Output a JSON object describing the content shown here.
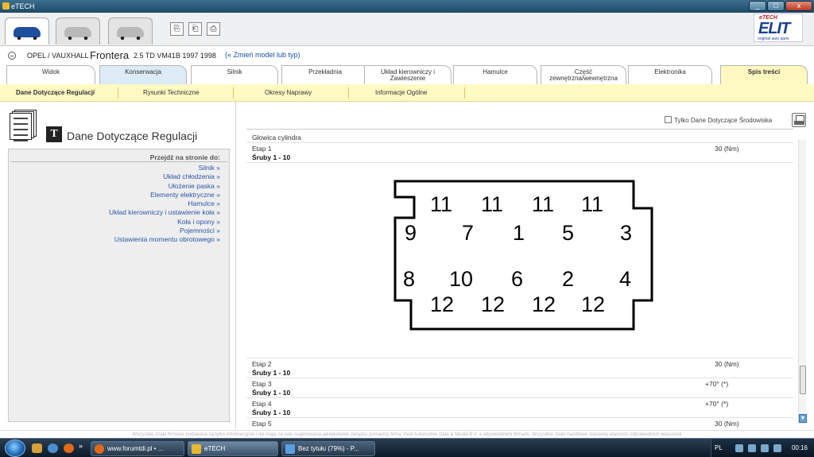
{
  "window": {
    "title": "eTECH",
    "buttons": [
      "_",
      "□",
      "x"
    ]
  },
  "toolbar": {
    "tools": [
      "⎘",
      "⎗",
      "⎙"
    ],
    "logo": {
      "brand_top": "eTECH",
      "brand": "ELIT",
      "tagline": "original auto parts"
    }
  },
  "vehicle": {
    "make": "OPEL / VAUXHALL",
    "model": "Frontera",
    "spec": "2.5 TD VM41B 1997 1998",
    "change_link": "(« Zmień model lub typ)"
  },
  "main_tabs": [
    "Widok",
    "Konserwacja",
    "Silnik",
    "Przekładnia",
    "Układ kierowniczy i Zawieszenie",
    "Hamulce",
    "Część zewnętrzna/wewnętrzna",
    "Elektronika",
    "Spis treści"
  ],
  "sub_tabs": [
    "Dane Dotyczące Regulacji",
    "Rysunki Techniczne",
    "Okresy Naprawy",
    "Informacje Ogólne"
  ],
  "left_panel": {
    "title": "Dane Dotyczące Regulacji",
    "jump_title": "Przejdź na stronie do:",
    "links": [
      "Silnik »",
      "Układ chłodzenia »",
      "Ułożenie paska »",
      "Elementy elektryczne »",
      "Hamulce »",
      "Układ kierowniczy i ustawienie koła »",
      "Koła i opony »",
      "Pojemności »",
      "Ustawienia momentu obrotowego »"
    ]
  },
  "content": {
    "env_filter_label": "Tylko Dane Dotyczące Środowiska",
    "section": "Głowica cylindra",
    "steps": [
      {
        "etap": "Etap 1",
        "bolts": "Śruby 1 - 10",
        "value": "30 (Nm)"
      },
      {
        "etap": "Etap 2",
        "bolts": "Śruby 1 - 10",
        "value": "30 (Nm)"
      },
      {
        "etap": "Etap 3",
        "bolts": "Śruby 1 - 10",
        "value": "+70° (*)"
      },
      {
        "etap": "Etap 4",
        "bolts": "Śruby 1 - 10",
        "value": "+70° (*)"
      },
      {
        "etap": "Etap 5",
        "bolts": "",
        "value": "30 (Nm)"
      }
    ],
    "diagram": {
      "row_top": [
        "11",
        "11",
        "11",
        "11"
      ],
      "row_upper": [
        "9",
        "7",
        "1",
        "5",
        "3"
      ],
      "row_lower": [
        "8",
        "10",
        "6",
        "2",
        "4"
      ],
      "row_bottom": [
        "12",
        "12",
        "12",
        "12"
      ]
    },
    "scroll_down": "▼"
  },
  "disclaimer": "Wszystkie znaki firmowe podawane są tylko informacyjnie i nie mają na celu sugerowania jakiejkolwiek związku pomiędzy firmą Vivid Automotive Data & Media B.V. a odpowiednimi firmami. Wszystkie znaki handlowe stanowią własność odpowiednich właścicieli",
  "taskbar": {
    "windows": [
      "www.forumtdi.pl • ...",
      "eTECH",
      "Bez tytułu (79%) - P..."
    ],
    "more": "»",
    "tray": {
      "lang": "PL",
      "clock": "00:16"
    }
  }
}
